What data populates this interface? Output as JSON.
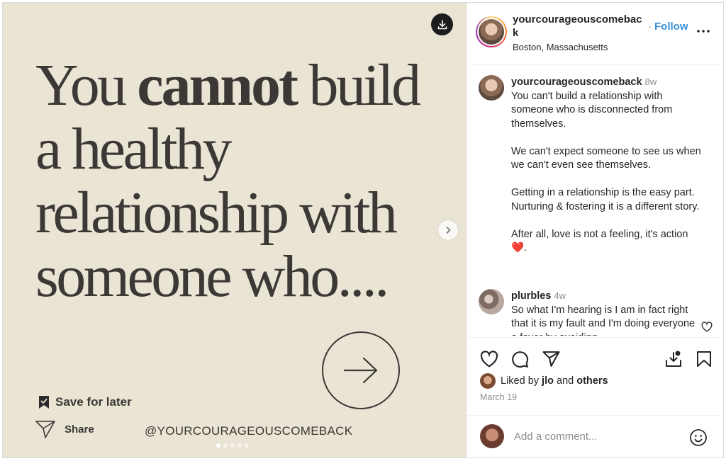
{
  "media": {
    "quote": {
      "line1_pre": "You ",
      "line1_bold": "cannot",
      "line1_post": " build",
      "line2": "a healthy",
      "line3": "relationship with",
      "line4": "someone who...."
    },
    "save_for_later": "Save for later",
    "share": "Share",
    "handle": "@YOURCOURAGEOUSCOMEBACK",
    "slide_count": 5,
    "active_slide": 1
  },
  "post_header": {
    "username": "yourcourageouscomeback",
    "follow_label": "Follow",
    "location": "Boston, Massachusetts",
    "more_icon": "more-horizontal-icon"
  },
  "caption": {
    "username": "yourcourageouscomeback",
    "time": "8w",
    "text": "You can't build a relationship with someone who is disconnected from themselves.\n\nWe can't expect someone to see us when we can't even see themselves.\n\nGetting in a relationship is the easy part. Nurturing & fostering it is a different story.\n\nAfter all, love is not a feeling, it's action",
    "emoji": "❤️."
  },
  "comments": [
    {
      "username": "plurbles",
      "time": "4w",
      "text": "So what I'm hearing is I am in fact right that it is my fault and I'm doing everyone a favor by avoiding"
    }
  ],
  "likes": {
    "prefix": "Liked by",
    "user": "jlo",
    "joiner": "and",
    "others": "others"
  },
  "date": "March 19",
  "add_comment": {
    "placeholder": "Add a comment..."
  },
  "colors": {
    "media_bg": "#e9e4d4",
    "text_dark": "#3b3835",
    "link_blue": "#3a8fd6"
  }
}
